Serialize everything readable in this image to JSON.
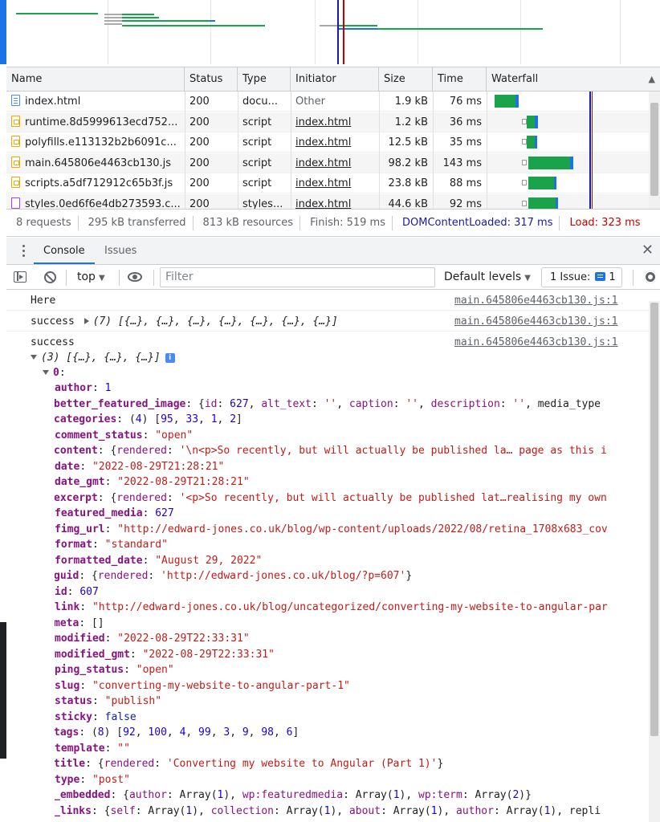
{
  "network": {
    "columns": [
      "Name",
      "Status",
      "Type",
      "Initiator",
      "Size",
      "Time",
      "Waterfall"
    ],
    "rows": [
      {
        "icon": "doc",
        "name": "index.html",
        "status": "200",
        "type": "docu...",
        "initiator": "Other",
        "initiator_link": false,
        "size": "1.9 kB",
        "time": "76 ms"
      },
      {
        "icon": "js",
        "name": "runtime.8d5999613ecd752...",
        "status": "200",
        "type": "script",
        "initiator": "index.html",
        "initiator_link": true,
        "size": "1.2 kB",
        "time": "36 ms"
      },
      {
        "icon": "js",
        "name": "polyfills.e113132b2b6091c...",
        "status": "200",
        "type": "script",
        "initiator": "index.html",
        "initiator_link": true,
        "size": "12.5 kB",
        "time": "35 ms"
      },
      {
        "icon": "js",
        "name": "main.645806e4463cb130.js",
        "status": "200",
        "type": "script",
        "initiator": "index.html",
        "initiator_link": true,
        "size": "98.2 kB",
        "time": "143 ms"
      },
      {
        "icon": "js",
        "name": "scripts.a5df712912c65b3f.js",
        "status": "200",
        "type": "script",
        "initiator": "index.html",
        "initiator_link": true,
        "size": "23.8 kB",
        "time": "88 ms"
      },
      {
        "icon": "css",
        "name": "styles.0ed6f6e4db273593.c...",
        "status": "200",
        "type": "styles...",
        "initiator": "index.html",
        "initiator_link": true,
        "size": "44.6 kB",
        "time": "92 ms"
      }
    ]
  },
  "summary": {
    "requests": "8 requests",
    "transferred": "295 kB transferred",
    "resources": "813 kB resources",
    "finish": "Finish: 519 ms",
    "dcl": "DOMContentLoaded: 317 ms",
    "load": "Load: 323 ms"
  },
  "drawer": {
    "tabs": [
      "Console",
      "Issues"
    ],
    "close_glyph": "✕"
  },
  "toolbar": {
    "context": "top",
    "filter_placeholder": "Filter",
    "levels": "Default levels",
    "issue_label": "1 Issue:",
    "issue_count": "1"
  },
  "console": {
    "messages": [
      {
        "text": "Here",
        "source": "main.645806e4463cb130.js:1"
      },
      {
        "text": "success",
        "preview": "(7) [{…}, {…}, {…}, {…}, {…}, {…}, {…}]",
        "source": "main.645806e4463cb130.js:1"
      },
      {
        "text": "success",
        "preview": "(3) [{…}, {…}, {…}]",
        "source": "main.645806e4463cb130.js:1"
      }
    ],
    "info_glyph": "i",
    "item_index": "0",
    "properties": [
      {
        "key": "author",
        "value": "1",
        "kind": "num",
        "expandable": false
      },
      {
        "key": "better_featured_image",
        "value": "{id: 627, alt_text: '', caption: '', description: '', media_type",
        "kind": "obj",
        "expandable": true
      },
      {
        "key": "categories",
        "value": "(4) [95, 33, 1, 2]",
        "kind": "arr",
        "expandable": true
      },
      {
        "key": "comment_status",
        "value": "\"open\"",
        "kind": "str",
        "expandable": false
      },
      {
        "key": "content",
        "value": "{rendered: '\\n<p>So recently, but will actually be published la… page as this i",
        "kind": "obj",
        "expandable": true
      },
      {
        "key": "date",
        "value": "\"2022-08-29T21:28:21\"",
        "kind": "str",
        "expandable": false
      },
      {
        "key": "date_gmt",
        "value": "\"2022-08-29T21:28:21\"",
        "kind": "str",
        "expandable": false
      },
      {
        "key": "excerpt",
        "value": "{rendered: '<p>So recently, but will actually be published lat…realising my own",
        "kind": "obj",
        "expandable": true
      },
      {
        "key": "featured_media",
        "value": "627",
        "kind": "num",
        "expandable": false
      },
      {
        "key": "fimg_url",
        "value": "\"http://edward-jones.co.uk/blog/wp-content/uploads/2022/08/retina_1708x683_cov",
        "kind": "str",
        "expandable": false
      },
      {
        "key": "format",
        "value": "\"standard\"",
        "kind": "str",
        "expandable": false
      },
      {
        "key": "formatted_date",
        "value": "\"August 29, 2022\"",
        "kind": "str",
        "expandable": false
      },
      {
        "key": "guid",
        "value": "{rendered: 'http://edward-jones.co.uk/blog/?p=607'}",
        "kind": "obj",
        "expandable": true
      },
      {
        "key": "id",
        "value": "607",
        "kind": "num",
        "expandable": false
      },
      {
        "key": "link",
        "value": "\"http://edward-jones.co.uk/blog/uncategorized/converting-my-website-to-angular-par",
        "kind": "str",
        "expandable": false
      },
      {
        "key": "meta",
        "value": "[]",
        "kind": "plain",
        "expandable": true
      },
      {
        "key": "modified",
        "value": "\"2022-08-29T22:33:31\"",
        "kind": "str",
        "expandable": false
      },
      {
        "key": "modified_gmt",
        "value": "\"2022-08-29T22:33:31\"",
        "kind": "str",
        "expandable": false
      },
      {
        "key": "ping_status",
        "value": "\"open\"",
        "kind": "str",
        "expandable": false
      },
      {
        "key": "slug",
        "value": "\"converting-my-website-to-angular-part-1\"",
        "kind": "str",
        "expandable": false
      },
      {
        "key": "status",
        "value": "\"publish\"",
        "kind": "str",
        "expandable": false
      },
      {
        "key": "sticky",
        "value": "false",
        "kind": "kw",
        "expandable": false
      },
      {
        "key": "tags",
        "value": "(8) [92, 100, 4, 99, 3, 9, 98, 6]",
        "kind": "arr",
        "expandable": true
      },
      {
        "key": "template",
        "value": "\"\"",
        "kind": "str",
        "expandable": false
      },
      {
        "key": "title",
        "value": "{rendered: 'Converting my website to Angular (Part 1)'}",
        "kind": "obj",
        "expandable": true
      },
      {
        "key": "type",
        "value": "\"post\"",
        "kind": "str",
        "expandable": false
      },
      {
        "key": "_embedded",
        "value": "{author: Array(1), wp:featuredmedia: Array(1), wp:term: Array(2)}",
        "kind": "plain",
        "expandable": true
      },
      {
        "key": "_links",
        "value": "{self: Array(1), collection: Array(1), about: Array(1), author: Array(1), repli",
        "kind": "plain",
        "expandable": true
      }
    ]
  },
  "colors": {
    "accent": "#1a73e8",
    "dcl": "#1a1aa6",
    "load": "#c80000",
    "waterfall_green": "#1aa34a",
    "waterfall_blue": "#1a73e8"
  }
}
